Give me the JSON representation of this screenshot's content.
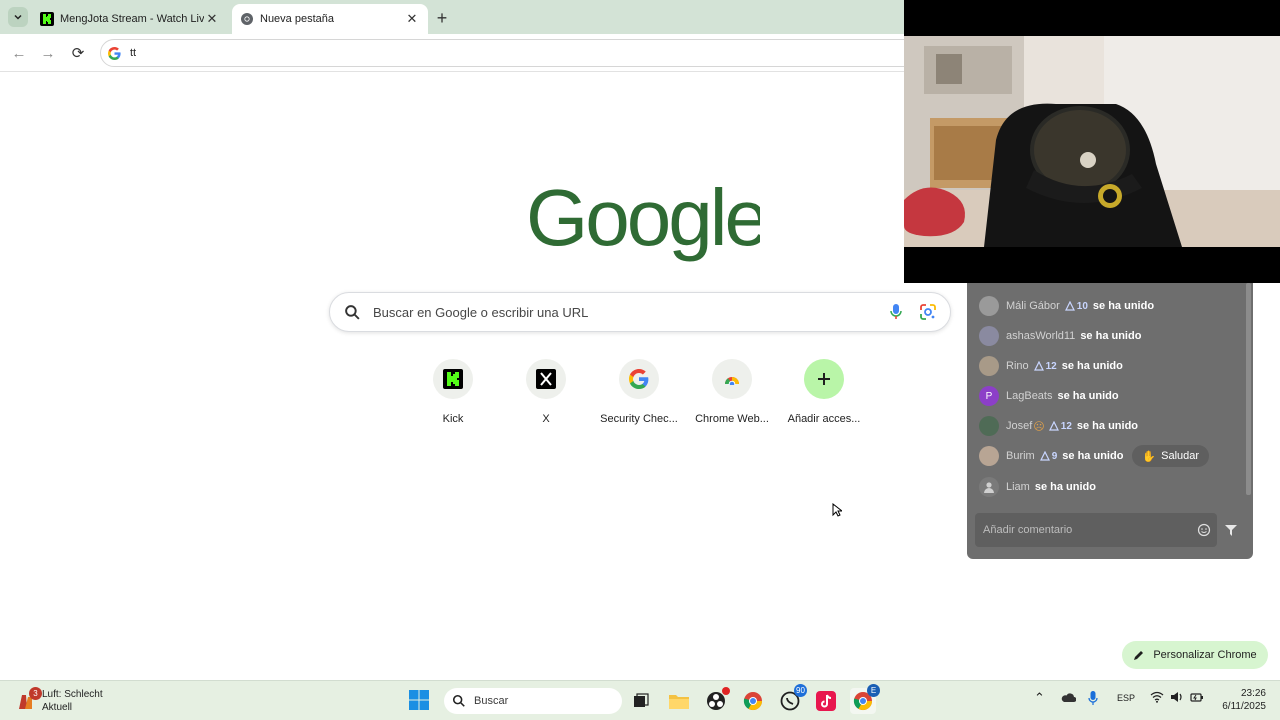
{
  "browser": {
    "tabs": [
      {
        "title": "MengJota Stream - Watch Live",
        "active": false
      },
      {
        "title": "Nueva pestaña",
        "active": true
      }
    ],
    "omnibox_value": "tt"
  },
  "newtab": {
    "search_placeholder": "Buscar en Google o escribir una URL",
    "shortcuts": [
      {
        "label": "Kick",
        "icon": "kick-icon"
      },
      {
        "label": "X",
        "icon": "x-icon"
      },
      {
        "label": "Security Chec...",
        "icon": "google-icon"
      },
      {
        "label": "Chrome Web...",
        "icon": "chrome-web-store-icon"
      },
      {
        "label": "Añadir acces...",
        "icon": "plus-icon"
      }
    ],
    "customize_label": "Personalizar Chrome"
  },
  "chat": {
    "messages": [
      {
        "user": "Máli Gábor",
        "badge": "10",
        "text": "se ha unido"
      },
      {
        "user": "ashasWorld11",
        "badge": "",
        "text": "se ha unido"
      },
      {
        "user": "Rino",
        "badge": "12",
        "text": "se ha unido"
      },
      {
        "user": "LagBeats",
        "badge": "",
        "text": "se ha unido",
        "initial": "P"
      },
      {
        "user": "Josef",
        "badge": "12",
        "text": "se ha unido"
      },
      {
        "user": "Burim",
        "badge": "9",
        "text": "se ha unido",
        "action": "Saludar"
      },
      {
        "user": "Liam",
        "badge": "",
        "text": "se ha unido"
      }
    ],
    "input_placeholder": "Añadir comentario"
  },
  "taskbar": {
    "weather_title": "Luft: Schlecht",
    "weather_sub": "Aktuell",
    "weather_badge": "3",
    "search_label": "Buscar",
    "whatsapp_badge": "90",
    "chrome_badge": "E",
    "language": "ESP",
    "time": "23:26",
    "date": "6/11/2025"
  },
  "colors": {
    "tabstrip": "#d3e3d6",
    "google_logo": "#2f6b34",
    "customize_bg": "#d7f5d0",
    "chat_bg": "#6e6e6e",
    "kick_green": "#53fc18"
  }
}
